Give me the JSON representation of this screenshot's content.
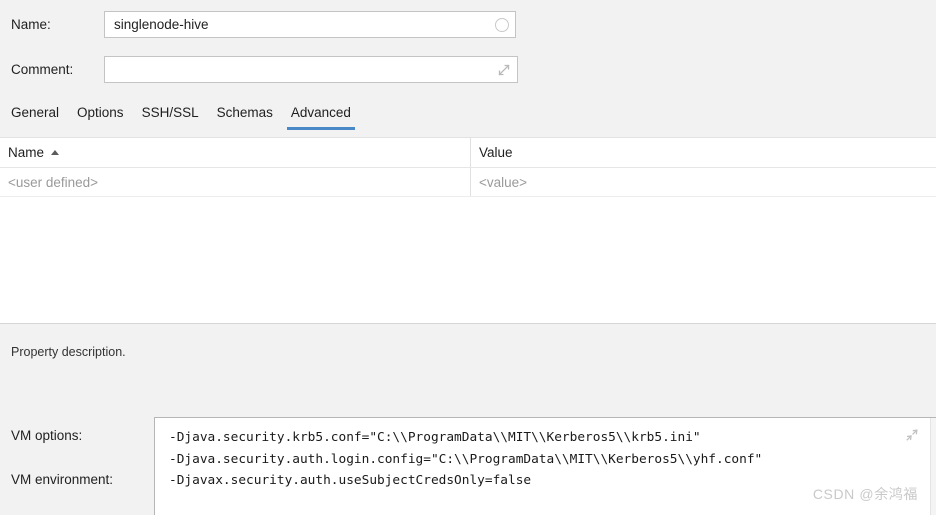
{
  "form": {
    "name_label": "Name:",
    "name_value": "singlenode-hive",
    "name_icon": "circle-icon",
    "comment_label": "Comment:",
    "comment_value": "",
    "comment_placeholder": "",
    "comment_icon": "expand-diagonal-icon"
  },
  "tabs": [
    {
      "label": "General",
      "active": false
    },
    {
      "label": "Options",
      "active": false
    },
    {
      "label": "SSH/SSL",
      "active": false
    },
    {
      "label": "Schemas",
      "active": false
    },
    {
      "label": "Advanced",
      "active": true
    }
  ],
  "table": {
    "columns": [
      {
        "header": "Name",
        "sort": "ascending",
        "sort_icon": "sort-ascending-icon"
      },
      {
        "header": "Value",
        "sort": "none"
      }
    ],
    "rows": [
      {
        "name": "<user defined>",
        "value": "<value>"
      }
    ]
  },
  "description": {
    "text": "Property description."
  },
  "vm": {
    "options_label": "VM options:",
    "environment_label": "VM environment:",
    "options_value": "-Djava.security.krb5.conf=\"C:\\\\ProgramData\\\\MIT\\\\Kerberos5\\\\krb5.ini\"\n-Djava.security.auth.login.config=\"C:\\\\ProgramData\\\\MIT\\\\Kerberos5\\\\yhf.conf\"\n-Djavax.security.auth.useSubjectCredsOnly=false",
    "collapse_icon": "collapse-diagonal-icon"
  },
  "watermark": {
    "text": "CSDN @余鸿福"
  },
  "colors": {
    "accent": "#4a88c7",
    "panel_bg": "#f2f2f2",
    "field_bg": "#ffffff",
    "placeholder": "#9a9a9a",
    "text": "#1f1f1f",
    "border": "#c4c4c4",
    "watermark": "#c9c9c9"
  }
}
